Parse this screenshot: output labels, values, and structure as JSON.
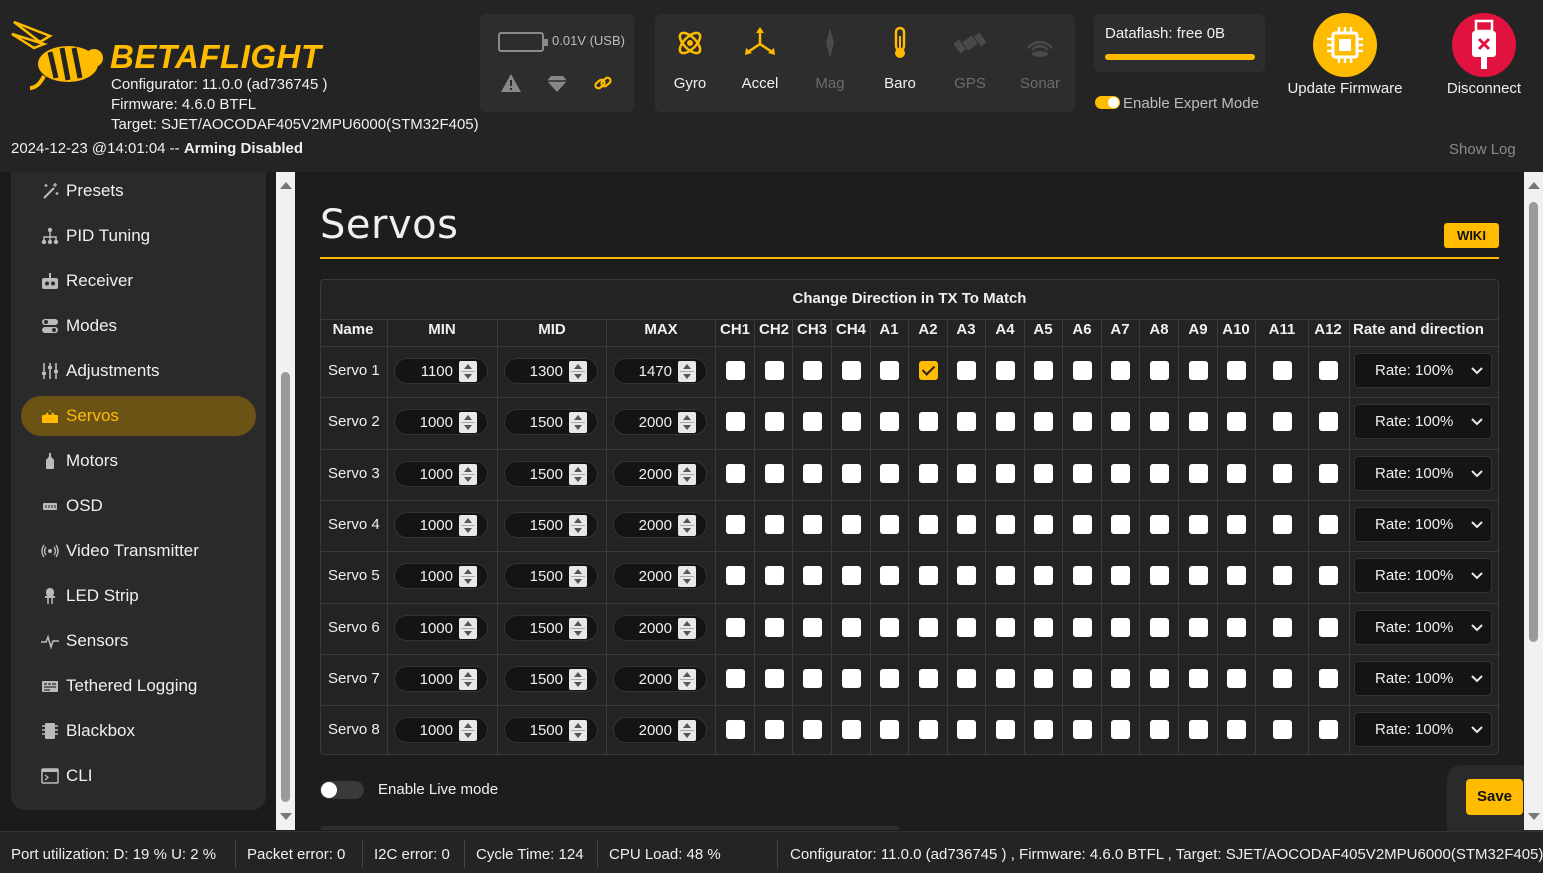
{
  "header": {
    "brand": "BETAFLIGHT",
    "configurator": "Configurator: 11.0.0 (ad736745 )",
    "firmware": "Firmware: 4.6.0 BTFL",
    "target": "Target: SJET/AOCODAF405V2MPU6000(STM32F405)",
    "status_time": "2024-12-23 @14:01:04 -- ",
    "status_state": "Arming Disabled",
    "battery": "0.01V (USB)",
    "sensors": [
      {
        "label": "Gyro",
        "icon": "gyro-icon",
        "active": true
      },
      {
        "label": "Accel",
        "icon": "accel-icon",
        "active": true
      },
      {
        "label": "Mag",
        "icon": "mag-icon",
        "active": false
      },
      {
        "label": "Baro",
        "icon": "baro-icon",
        "active": true
      },
      {
        "label": "GPS",
        "icon": "gps-icon",
        "active": false
      },
      {
        "label": "Sonar",
        "icon": "sonar-icon",
        "active": false
      }
    ],
    "dataflash": "Dataflash: free 0B",
    "expert_mode": "Enable Expert Mode",
    "update_firmware": "Update Firmware",
    "disconnect": "Disconnect",
    "show_log": "Show Log"
  },
  "sidebar": {
    "items": [
      {
        "label": "Presets",
        "icon": "wand-icon"
      },
      {
        "label": "PID Tuning",
        "icon": "pid-icon"
      },
      {
        "label": "Receiver",
        "icon": "receiver-icon"
      },
      {
        "label": "Modes",
        "icon": "modes-icon"
      },
      {
        "label": "Adjustments",
        "icon": "adjustments-icon"
      },
      {
        "label": "Servos",
        "icon": "servo-icon",
        "active": true
      },
      {
        "label": "Motors",
        "icon": "motor-icon"
      },
      {
        "label": "OSD",
        "icon": "osd-icon"
      },
      {
        "label": "Video Transmitter",
        "icon": "vtx-icon"
      },
      {
        "label": "LED Strip",
        "icon": "led-icon"
      },
      {
        "label": "Sensors",
        "icon": "sensors-icon"
      },
      {
        "label": "Tethered Logging",
        "icon": "logging-icon"
      },
      {
        "label": "Blackbox",
        "icon": "blackbox-icon"
      },
      {
        "label": "CLI",
        "icon": "cli-icon"
      }
    ]
  },
  "page": {
    "title": "Servos",
    "wiki": "WIKI",
    "caption": "Change Direction in TX To Match",
    "columns": [
      "Name",
      "MIN",
      "MID",
      "MAX",
      "CH1",
      "CH2",
      "CH3",
      "CH4",
      "A1",
      "A2",
      "A3",
      "A4",
      "A5",
      "A6",
      "A7",
      "A8",
      "A9",
      "A10",
      "A11",
      "A12",
      "Rate and direction"
    ],
    "servos": [
      {
        "name": "Servo 1",
        "min": "1100",
        "mid": "1300",
        "max": "1470",
        "checked": [
          5
        ],
        "rate": "Rate: 100%"
      },
      {
        "name": "Servo 2",
        "min": "1000",
        "mid": "1500",
        "max": "2000",
        "checked": [],
        "rate": "Rate: 100%"
      },
      {
        "name": "Servo 3",
        "min": "1000",
        "mid": "1500",
        "max": "2000",
        "checked": [],
        "rate": "Rate: 100%"
      },
      {
        "name": "Servo 4",
        "min": "1000",
        "mid": "1500",
        "max": "2000",
        "checked": [],
        "rate": "Rate: 100%"
      },
      {
        "name": "Servo 5",
        "min": "1000",
        "mid": "1500",
        "max": "2000",
        "checked": [],
        "rate": "Rate: 100%"
      },
      {
        "name": "Servo 6",
        "min": "1000",
        "mid": "1500",
        "max": "2000",
        "checked": [],
        "rate": "Rate: 100%"
      },
      {
        "name": "Servo 7",
        "min": "1000",
        "mid": "1500",
        "max": "2000",
        "checked": [],
        "rate": "Rate: 100%"
      },
      {
        "name": "Servo 8",
        "min": "1000",
        "mid": "1500",
        "max": "2000",
        "checked": [],
        "rate": "Rate: 100%"
      }
    ],
    "live_mode": "Enable Live mode",
    "save": "Save"
  },
  "statusbar": {
    "port": "Port utilization: D: 19 % U: 2 %",
    "packet": "Packet error: 0",
    "i2c": "I2C error: 0",
    "cycle": "Cycle Time: 124",
    "cpu": "CPU Load: 48 %",
    "version": "Configurator: 11.0.0 (ad736745 ) , Firmware: 4.6.0 BTFL , Target: SJET/AOCODAF405V2MPU6000(STM32F405)"
  },
  "colors": {
    "accent": "#ffbb00",
    "disconnect": "#e2123f"
  }
}
